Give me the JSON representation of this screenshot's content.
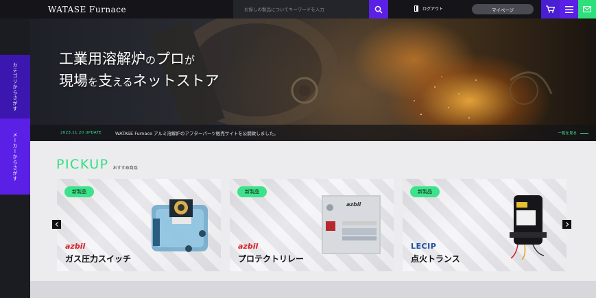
{
  "header": {
    "logo": "WATASE Furnace",
    "search_placeholder": "お探しの製品についてキーワードを入力",
    "logout_label": "ログアウト",
    "mypage_label": "マイページ"
  },
  "side": {
    "category_label": "カテゴリからさがす",
    "maker_label": "メーカーからさがす"
  },
  "hero": {
    "line1_a": "工業用溶解炉",
    "line1_b": "の",
    "line1_c": "プロ",
    "line1_d": "が",
    "line2_a": "現場",
    "line2_b": "を",
    "line2_c": "支",
    "line2_d": "える",
    "line2_e": "ネットストア"
  },
  "news": {
    "date": "2023.11.20 UPDATE",
    "text": "WATASE Furnace アルミ溶解炉のアフターパーツ販売サイトを公開致しました。",
    "more_label": "一覧を見る"
  },
  "pickup": {
    "title": "PICKUP",
    "subtitle": "おすすめ商品",
    "items": [
      {
        "badge": "新製品",
        "brand": "azbil",
        "name": "ガス圧力スイッチ"
      },
      {
        "badge": "新製品",
        "brand": "azbil",
        "name": "プロテクトリレー"
      },
      {
        "badge": "新製品",
        "brand": "LECIP",
        "name": "点火トランス"
      }
    ]
  },
  "colors": {
    "accent_purple": "#5b20e6",
    "accent_green": "#2ee07a",
    "azbil_red": "#d92029",
    "lecip_blue": "#1e4fa0"
  }
}
